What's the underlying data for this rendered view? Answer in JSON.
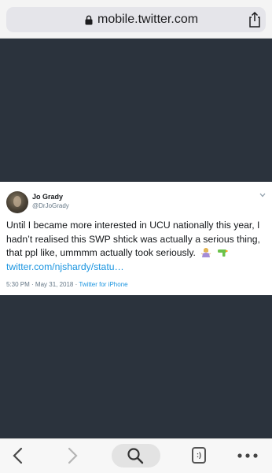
{
  "browser": {
    "url": "mobile.twitter.com",
    "icons": {
      "lock": "lock-icon",
      "share": "share-icon",
      "back": "chevron-left-icon",
      "forward": "chevron-right-icon",
      "search": "search-icon",
      "tabs": "tabs-icon",
      "more": "more-horizontal-icon"
    },
    "tabs_label": ":)"
  },
  "tweet": {
    "author_name": "Jo Grady",
    "author_handle": "@DrJoGrady",
    "text": "Until I became more interested in UCU nationally this year, I hadn’t realised this SWP shtick was actually a serious thing, that ppl like, ummmm actually took seriously.",
    "emojis": [
      "woman-shrugging-emoji",
      "water-pistol-emoji"
    ],
    "link": "twitter.com/njshardy/statu…",
    "timestamp": "5:30 PM · May 31, 2018 · ",
    "source": "Twitter for iPhone"
  },
  "colors": {
    "background": "#2b333d",
    "link": "#1b95e0",
    "text": "#14171a",
    "muted": "#657786"
  }
}
